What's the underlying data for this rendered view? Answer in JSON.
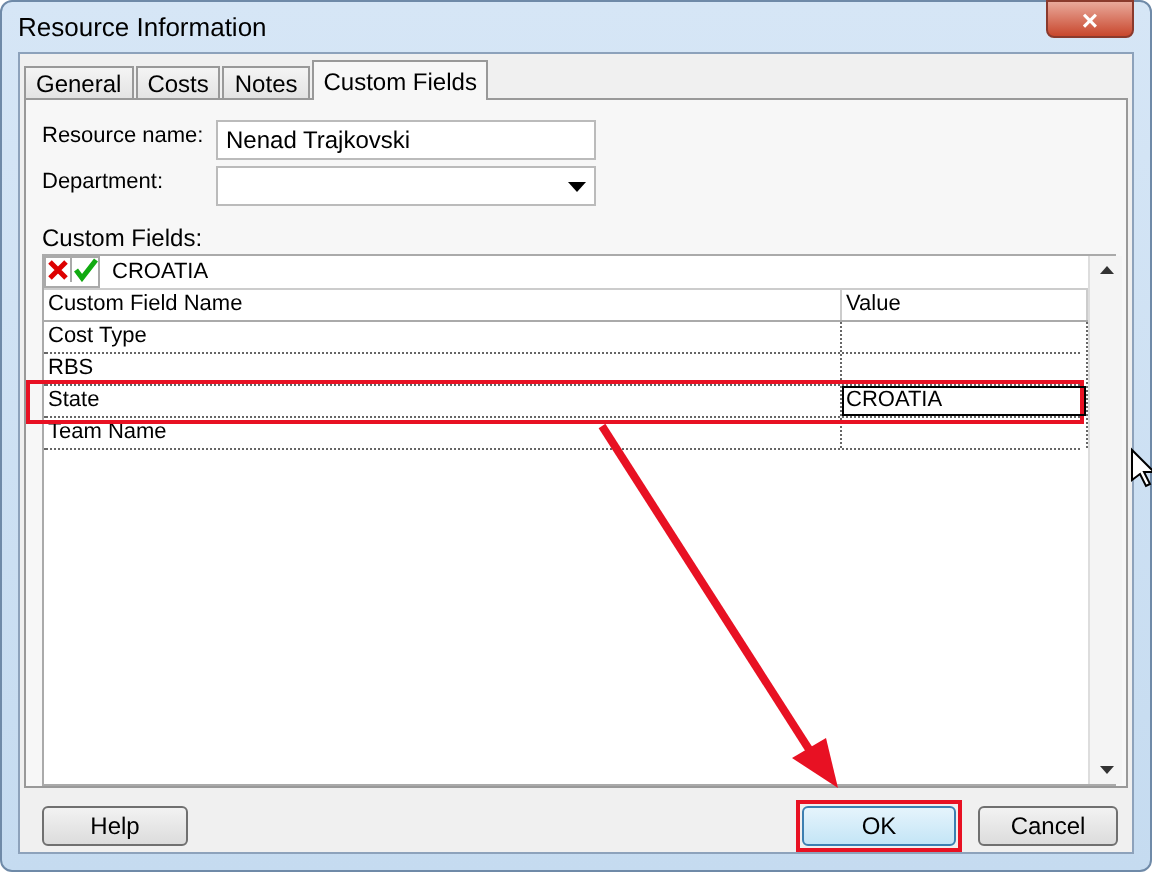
{
  "window": {
    "title": "Resource Information",
    "close": "×"
  },
  "tabs": [
    {
      "label": "General",
      "selected": false
    },
    {
      "label": "Costs",
      "selected": false
    },
    {
      "label": "Notes",
      "selected": false
    },
    {
      "label": "Custom Fields",
      "selected": true
    }
  ],
  "fields": [
    {
      "label": "Resource name:",
      "kind": "text",
      "value": "Nenad Trajkovski"
    },
    {
      "label": "Department:",
      "kind": "dropdown"
    }
  ],
  "custom_fields": {
    "label": "Custom Fields:",
    "edit_value": "CROATIA",
    "columns": [
      "Custom Field Name",
      "Value"
    ],
    "rows": [
      {
        "name": "Cost Type",
        "value": "",
        "selected": false,
        "annotated": false
      },
      {
        "name": "RBS",
        "value": "",
        "selected": false,
        "annotated": false
      },
      {
        "name": "State",
        "value": "CROATIA",
        "selected": true,
        "annotated": true
      },
      {
        "name": "Team Name",
        "value": "",
        "selected": false,
        "annotated": false
      }
    ]
  },
  "buttons": [
    {
      "label": "Help",
      "default": false,
      "annotated": false
    },
    {
      "label": "OK",
      "default": true,
      "annotated": true
    },
    {
      "label": "Cancel",
      "default": false,
      "annotated": false
    }
  ]
}
